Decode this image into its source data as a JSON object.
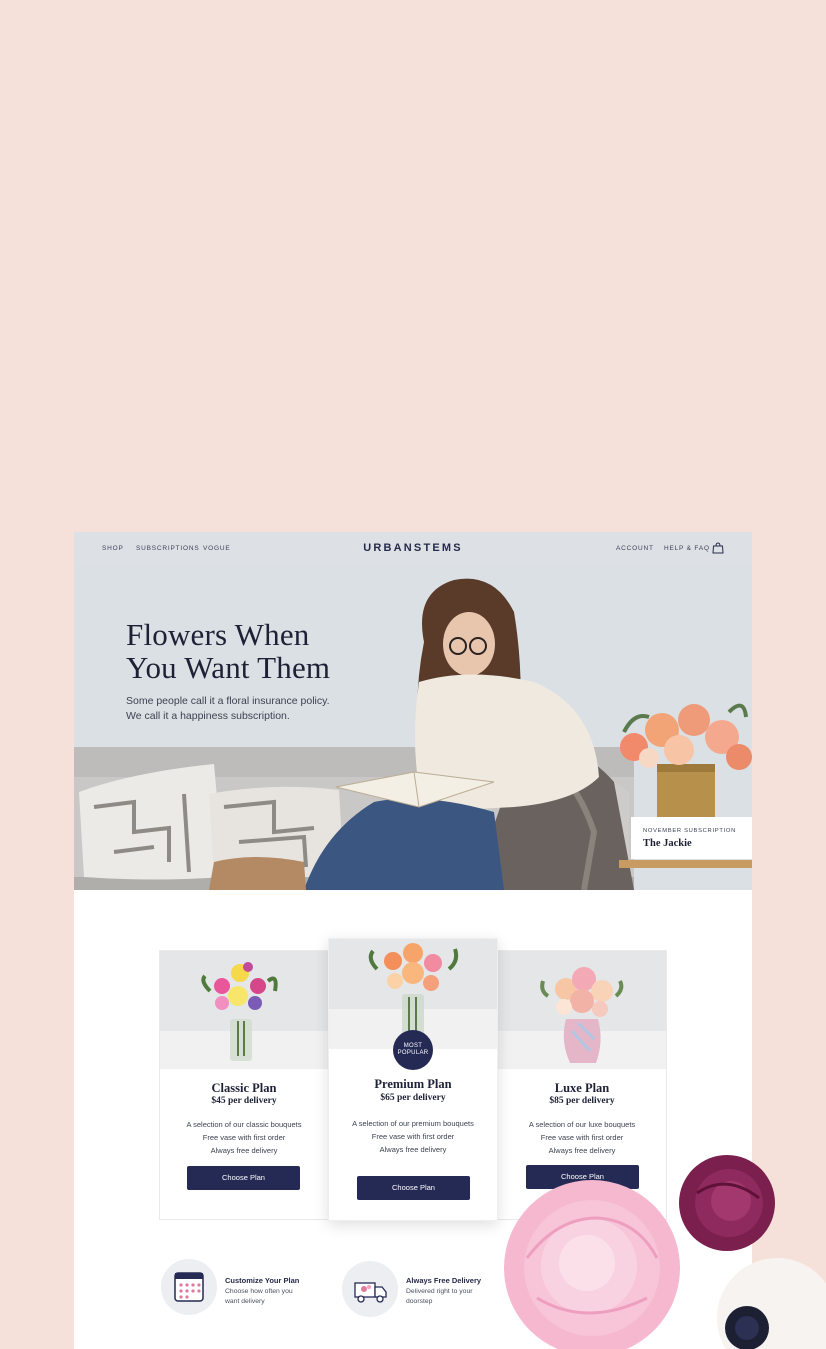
{
  "nav": {
    "left": [
      "SHOP",
      "SUBSCRIPTIONS",
      "VOGUE"
    ],
    "brand": "URBANSTEMS",
    "right": [
      "ACCOUNT",
      "HELP & FAQ"
    ],
    "bag_icon": "shopping-bag-icon"
  },
  "hero": {
    "title_line1": "Flowers When",
    "title_line2": "You Want Them",
    "sub_line1": "Some people call it a floral insurance policy.",
    "sub_line2": "We call it a happiness subscription.",
    "card_eyebrow": "NOVEMBER SUBSCRIPTION",
    "card_name": "The Jackie"
  },
  "plans": [
    {
      "title": "Classic Plan",
      "price": "$45 per delivery",
      "features": [
        "A selection of our classic bouquets",
        "Free vase with first order",
        "Always free delivery"
      ],
      "button": "Choose Plan"
    },
    {
      "title": "Premium Plan",
      "price": "$65 per delivery",
      "badge_line1": "MOST",
      "badge_line2": "POPULAR",
      "features": [
        "A selection of our premium bouquets",
        "Free vase with first order",
        "Always free delivery"
      ],
      "button": "Choose Plan"
    },
    {
      "title": "Luxe Plan",
      "price": "$85 per delivery",
      "features": [
        "A selection of our luxe bouquets",
        "Free vase with first order",
        "Always free delivery"
      ],
      "button": "Choose Plan"
    }
  ],
  "features": [
    {
      "icon": "calendar-icon",
      "title": "Customize Your Plan",
      "desc_line1": "Choose how often you",
      "desc_line2": "want delivery"
    },
    {
      "icon": "delivery-truck-icon",
      "title": "Always Free Delivery",
      "desc_line1": "Delivered right to your",
      "desc_line2": "doorstep"
    }
  ],
  "colors": {
    "background": "#f6e1da",
    "navy": "#252a55",
    "hero_bg": "#dbe0e4"
  }
}
